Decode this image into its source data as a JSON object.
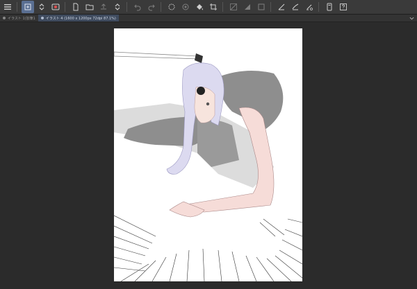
{
  "toolbar": {
    "icons": [
      "menu-icon",
      "new-document-icon",
      "chevron-updown-icon",
      "clip-studio-icon",
      "new-file-icon",
      "open-folder-icon",
      "export-icon",
      "chevron-updown-icon",
      "undo-icon",
      "redo-icon",
      "lasso-icon",
      "select-all-icon",
      "fill-icon",
      "crop-icon",
      "gradient-icon",
      "tone-icon",
      "frame-icon",
      "pen-pressure-icon",
      "pen-stabilizer-icon",
      "pen-settings-icon",
      "device-icon",
      "help-icon"
    ]
  },
  "tabs": [
    {
      "label": "イラスト 1(加筆1",
      "active": false
    },
    {
      "label": "イラスト 4 (1600 x 1200px 72dpi 87.1%)",
      "active": true
    }
  ],
  "colors": {
    "background": "#2b2b2b",
    "toolbar": "#3a3a3a",
    "active_tool": "#5a6f92",
    "canvas": "#ffffff"
  }
}
